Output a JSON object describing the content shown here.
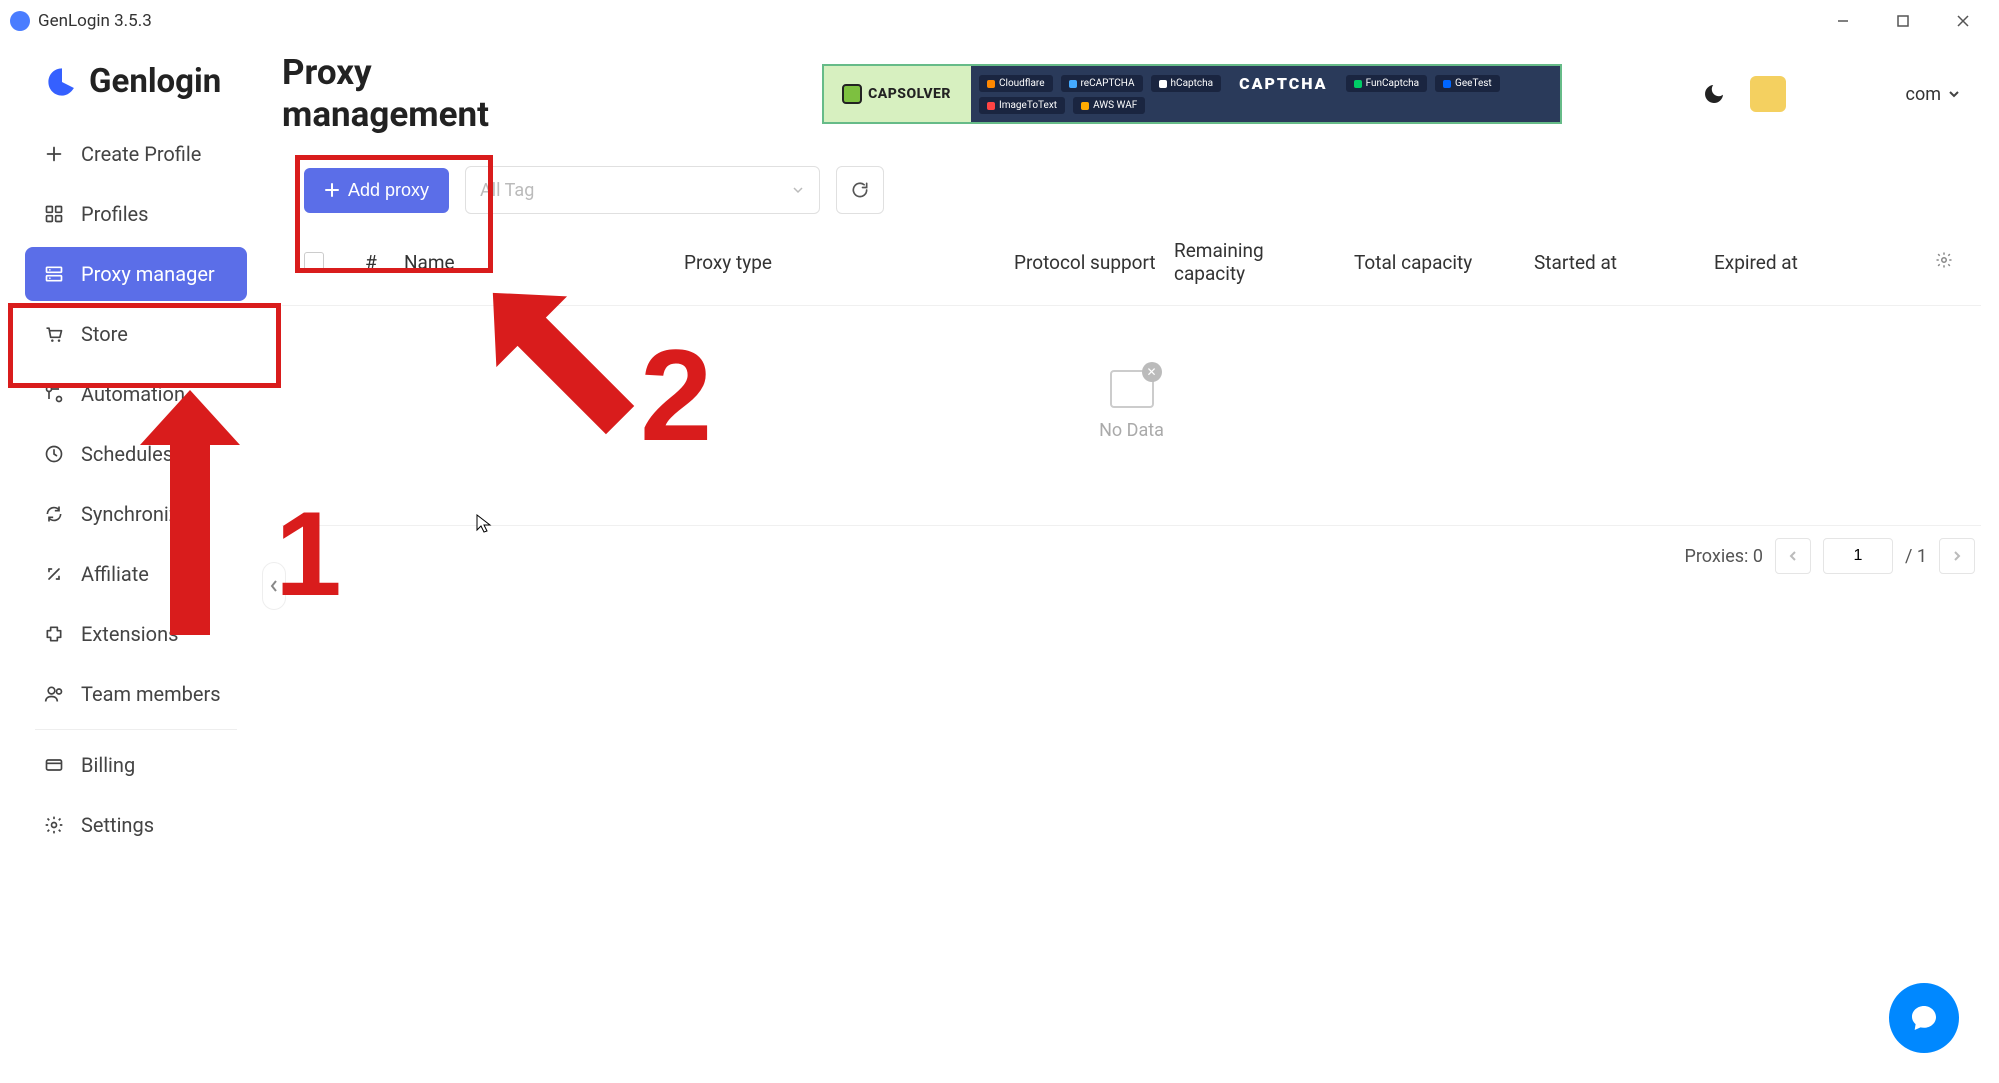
{
  "app": {
    "title": "GenLogin 3.5.3"
  },
  "logo": {
    "text": "Genlogin"
  },
  "sidebar": {
    "create": "Create Profile",
    "profiles": "Profiles",
    "proxy": "Proxy manager",
    "store": "Store",
    "automation": "Automation",
    "schedules": "Schedules",
    "synchronizer": "Synchronizer",
    "affiliate": "Affiliate",
    "extensions": "Extensions",
    "team": "Team members",
    "billing": "Billing",
    "settings": "Settings"
  },
  "page": {
    "title": "Proxy management"
  },
  "banner": {
    "brand": "CAPSOLVER",
    "center": "CAPTCHA",
    "chips": [
      "Cloudflare",
      "reCAPTCHA",
      "hCaptcha",
      "FunCaptcha",
      "GeeTest",
      "ImageToText",
      "AWS WAF"
    ]
  },
  "account": {
    "text": "com"
  },
  "toolbar": {
    "add_proxy": "Add proxy",
    "all_tag": "All Tag"
  },
  "table": {
    "cols": {
      "num": "#",
      "name": "Name",
      "proxy_type": "Proxy type",
      "protocol": "Protocol support",
      "remaining": "Remaining capacity",
      "total": "Total capacity",
      "started": "Started at",
      "expired": "Expired at"
    },
    "empty": "No Data"
  },
  "footer": {
    "proxies_label": "Proxies: 0",
    "page": "1",
    "total_pages": "/ 1"
  },
  "annotations": {
    "one": "1",
    "two": "2"
  }
}
